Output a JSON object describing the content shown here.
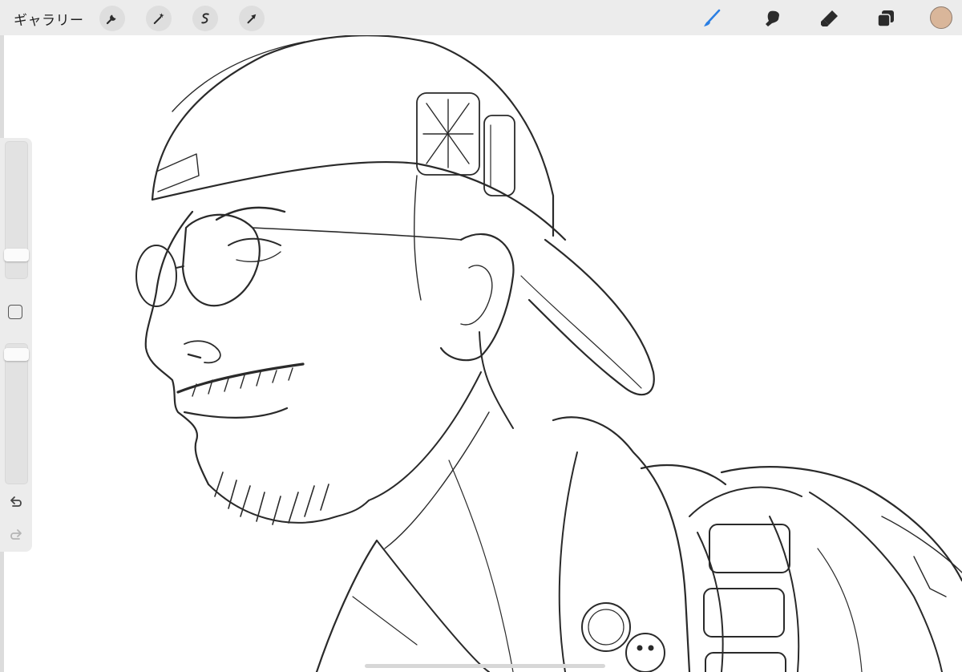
{
  "toolbar": {
    "gallery_label": "ギャラリー",
    "left_tools": [
      {
        "name": "actions",
        "icon": "wrench-icon"
      },
      {
        "name": "adjustments",
        "icon": "magic-wand-icon"
      },
      {
        "name": "selection",
        "icon": "selection-s-icon"
      },
      {
        "name": "transform",
        "icon": "arrow-cursor-icon"
      }
    ],
    "right_tools": [
      {
        "name": "brush",
        "icon": "brush-icon",
        "active": true
      },
      {
        "name": "smudge",
        "icon": "smudge-finger-icon",
        "active": false
      },
      {
        "name": "eraser",
        "icon": "eraser-icon",
        "active": false
      },
      {
        "name": "layers",
        "icon": "layers-icon",
        "active": false
      }
    ],
    "current_color": "#d9b69a",
    "accent_color": "#2b7fe3"
  },
  "sidebar": {
    "brush_size_level": 0.14,
    "opacity_level": 0.96,
    "modify_button": "square-icon",
    "undo": "undo-arrow-icon",
    "redo": "redo-arrow-icon"
  },
  "canvas": {
    "content": "pencil-sketch-illustration",
    "background": "#ffffff"
  }
}
